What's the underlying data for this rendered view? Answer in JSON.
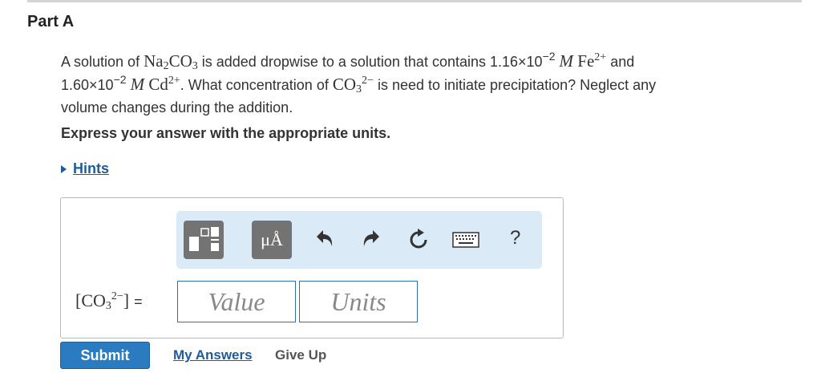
{
  "part": {
    "title": "Part A"
  },
  "question": {
    "t1": "A solution of ",
    "na": "Na",
    "na_sub": "2",
    "co": "CO",
    "co_sub": "3",
    "t2": " is added dropwise to a solution that contains 1.16×10",
    "exp1": "−2",
    "unit_m": "M",
    "fe": "Fe",
    "fe_sup": "2+",
    "t3": " and",
    "t4": "1.60×10",
    "exp2": "−2",
    "cd": "Cd",
    "cd_sup": "2+",
    "t5": ". What concentration of ",
    "co3_sup": "2−",
    "t6": " is need to initiate precipitation? Neglect any",
    "t7": "volume changes during the addition."
  },
  "instruction": "Express your answer with the appropriate units.",
  "hints": {
    "label": "Hints"
  },
  "toolbar": {
    "units_glyph": "μÅ",
    "help": "?"
  },
  "answer": {
    "label_co": "CO",
    "label_sub": "3",
    "label_sup": "2−",
    "label_open": "[",
    "label_close": "]",
    "equals": "=",
    "value_placeholder": "Value",
    "units_placeholder": "Units"
  },
  "actions": {
    "submit": "Submit",
    "my_answers": "My Answers",
    "give_up": "Give Up"
  },
  "colors": {
    "accent": "#2a7bc0",
    "link": "#1f5c99",
    "toolbar_bg": "#dbeaf7",
    "tool_button": "#737373"
  }
}
